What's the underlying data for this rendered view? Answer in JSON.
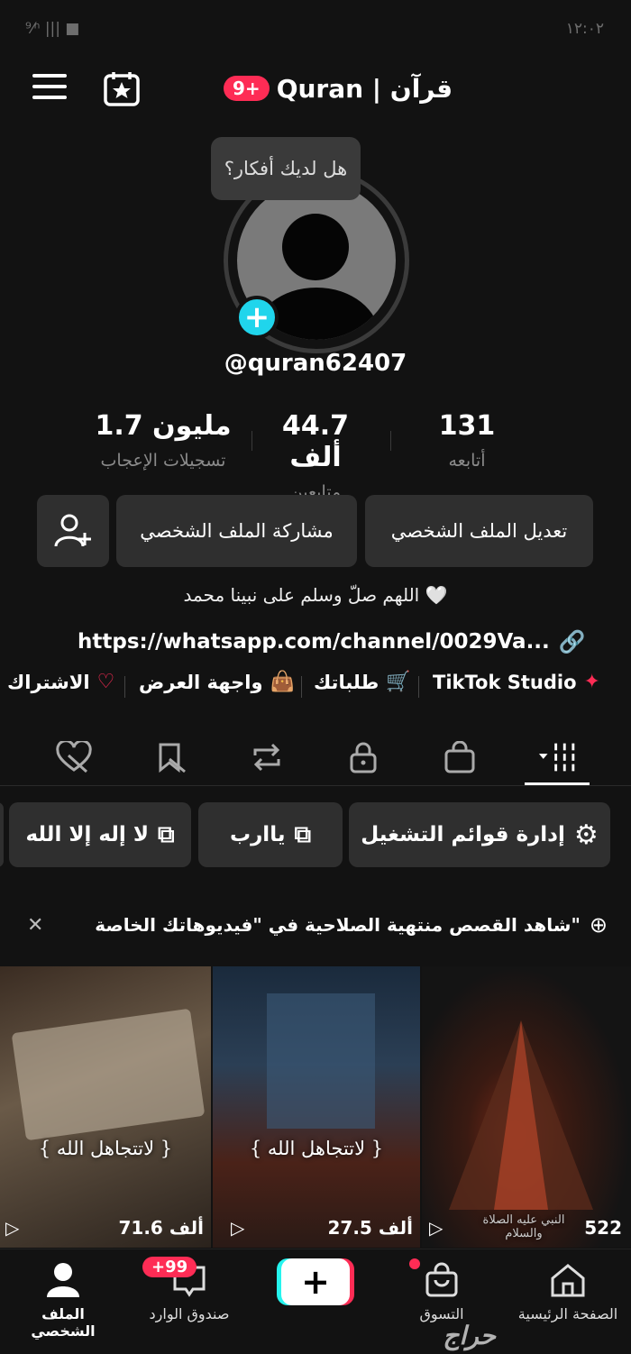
{
  "status_bar": {
    "left": "⁹⁄ⁿ ||| ■",
    "right": "١٢:٠٢"
  },
  "header": {
    "badge": "9+",
    "title": "Quran | قرآن"
  },
  "tooltip": "هل لديك أفكار؟",
  "profile": {
    "username": "@quran62407",
    "stats": [
      {
        "value": "131",
        "label": "أتابعه"
      },
      {
        "value": "44.7 ألف",
        "label": "متابعين"
      },
      {
        "value": "1.7 مليون",
        "label": "تسجيلات الإعجاب"
      }
    ],
    "buttons": {
      "edit": "تعديل الملف الشخصي",
      "share": "مشاركة الملف الشخصي"
    },
    "bio": "اللهم صلّ وسلم على نبينا محمد 🤍",
    "link": "https://whatsapp.com/channel/0029Va..."
  },
  "shortcuts": [
    "TikTok Studio",
    "طلباتك",
    "واجهة العرض",
    "الاشتراك"
  ],
  "playlists": {
    "manage": "إدارة قوائم التشغيل",
    "p1": "ياارب",
    "p2": "لا إله إلا الله"
  },
  "banner": "شاهد القصص منتهية الصلاحية في \"فيديوهاتك الخاصة\"",
  "videos": [
    {
      "views": "522",
      "caption": "النبي عليه الصلاة والسلام"
    },
    {
      "views": "27.5 ألف",
      "caption": "{ لاتتجاهل الله }"
    },
    {
      "views": "71.6 ألف",
      "caption": "{ لاتتجاهل الله }"
    }
  ],
  "nav": {
    "home": "الصفحة الرئيسية",
    "shop": "التسوق",
    "inbox": "صندوق الوارد",
    "inbox_badge": "+99",
    "profile": "الملف الشخصي"
  },
  "watermark": "حراج",
  "colors": {
    "accent": "#fe2c55",
    "cyan": "#20d5ec",
    "background": "#121212"
  }
}
